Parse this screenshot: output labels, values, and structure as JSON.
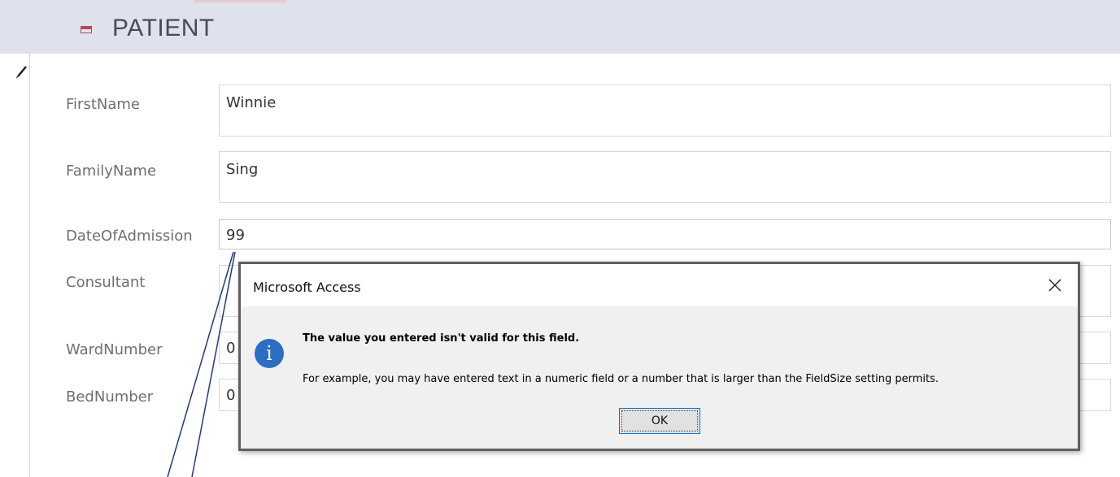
{
  "form": {
    "title": "PATIENT"
  },
  "fields": [
    {
      "label": "FirstName",
      "value": "Winnie"
    },
    {
      "label": "FamilyName",
      "value": "Sing"
    },
    {
      "label": "DateOfAdmission",
      "value": "99"
    },
    {
      "label": "Consultant",
      "value": ""
    },
    {
      "label": "WardNumber",
      "value": "0"
    },
    {
      "label": "BedNumber",
      "value": "0"
    }
  ],
  "dialog": {
    "title": "Microsoft Access",
    "heading": "The value you entered isn't valid for this field.",
    "message": "For example, you may have entered text in a numeric field or a number that is larger than the FieldSize setting permits.",
    "ok_label": "OK"
  },
  "icons": {
    "form": "form-icon",
    "record": "pencil-icon",
    "info": "info-icon",
    "close": "close-icon"
  },
  "colors": {
    "title_bar": "#dfe1ec",
    "info_icon": "#2a6fc4",
    "button_focus": "#0078d7"
  }
}
